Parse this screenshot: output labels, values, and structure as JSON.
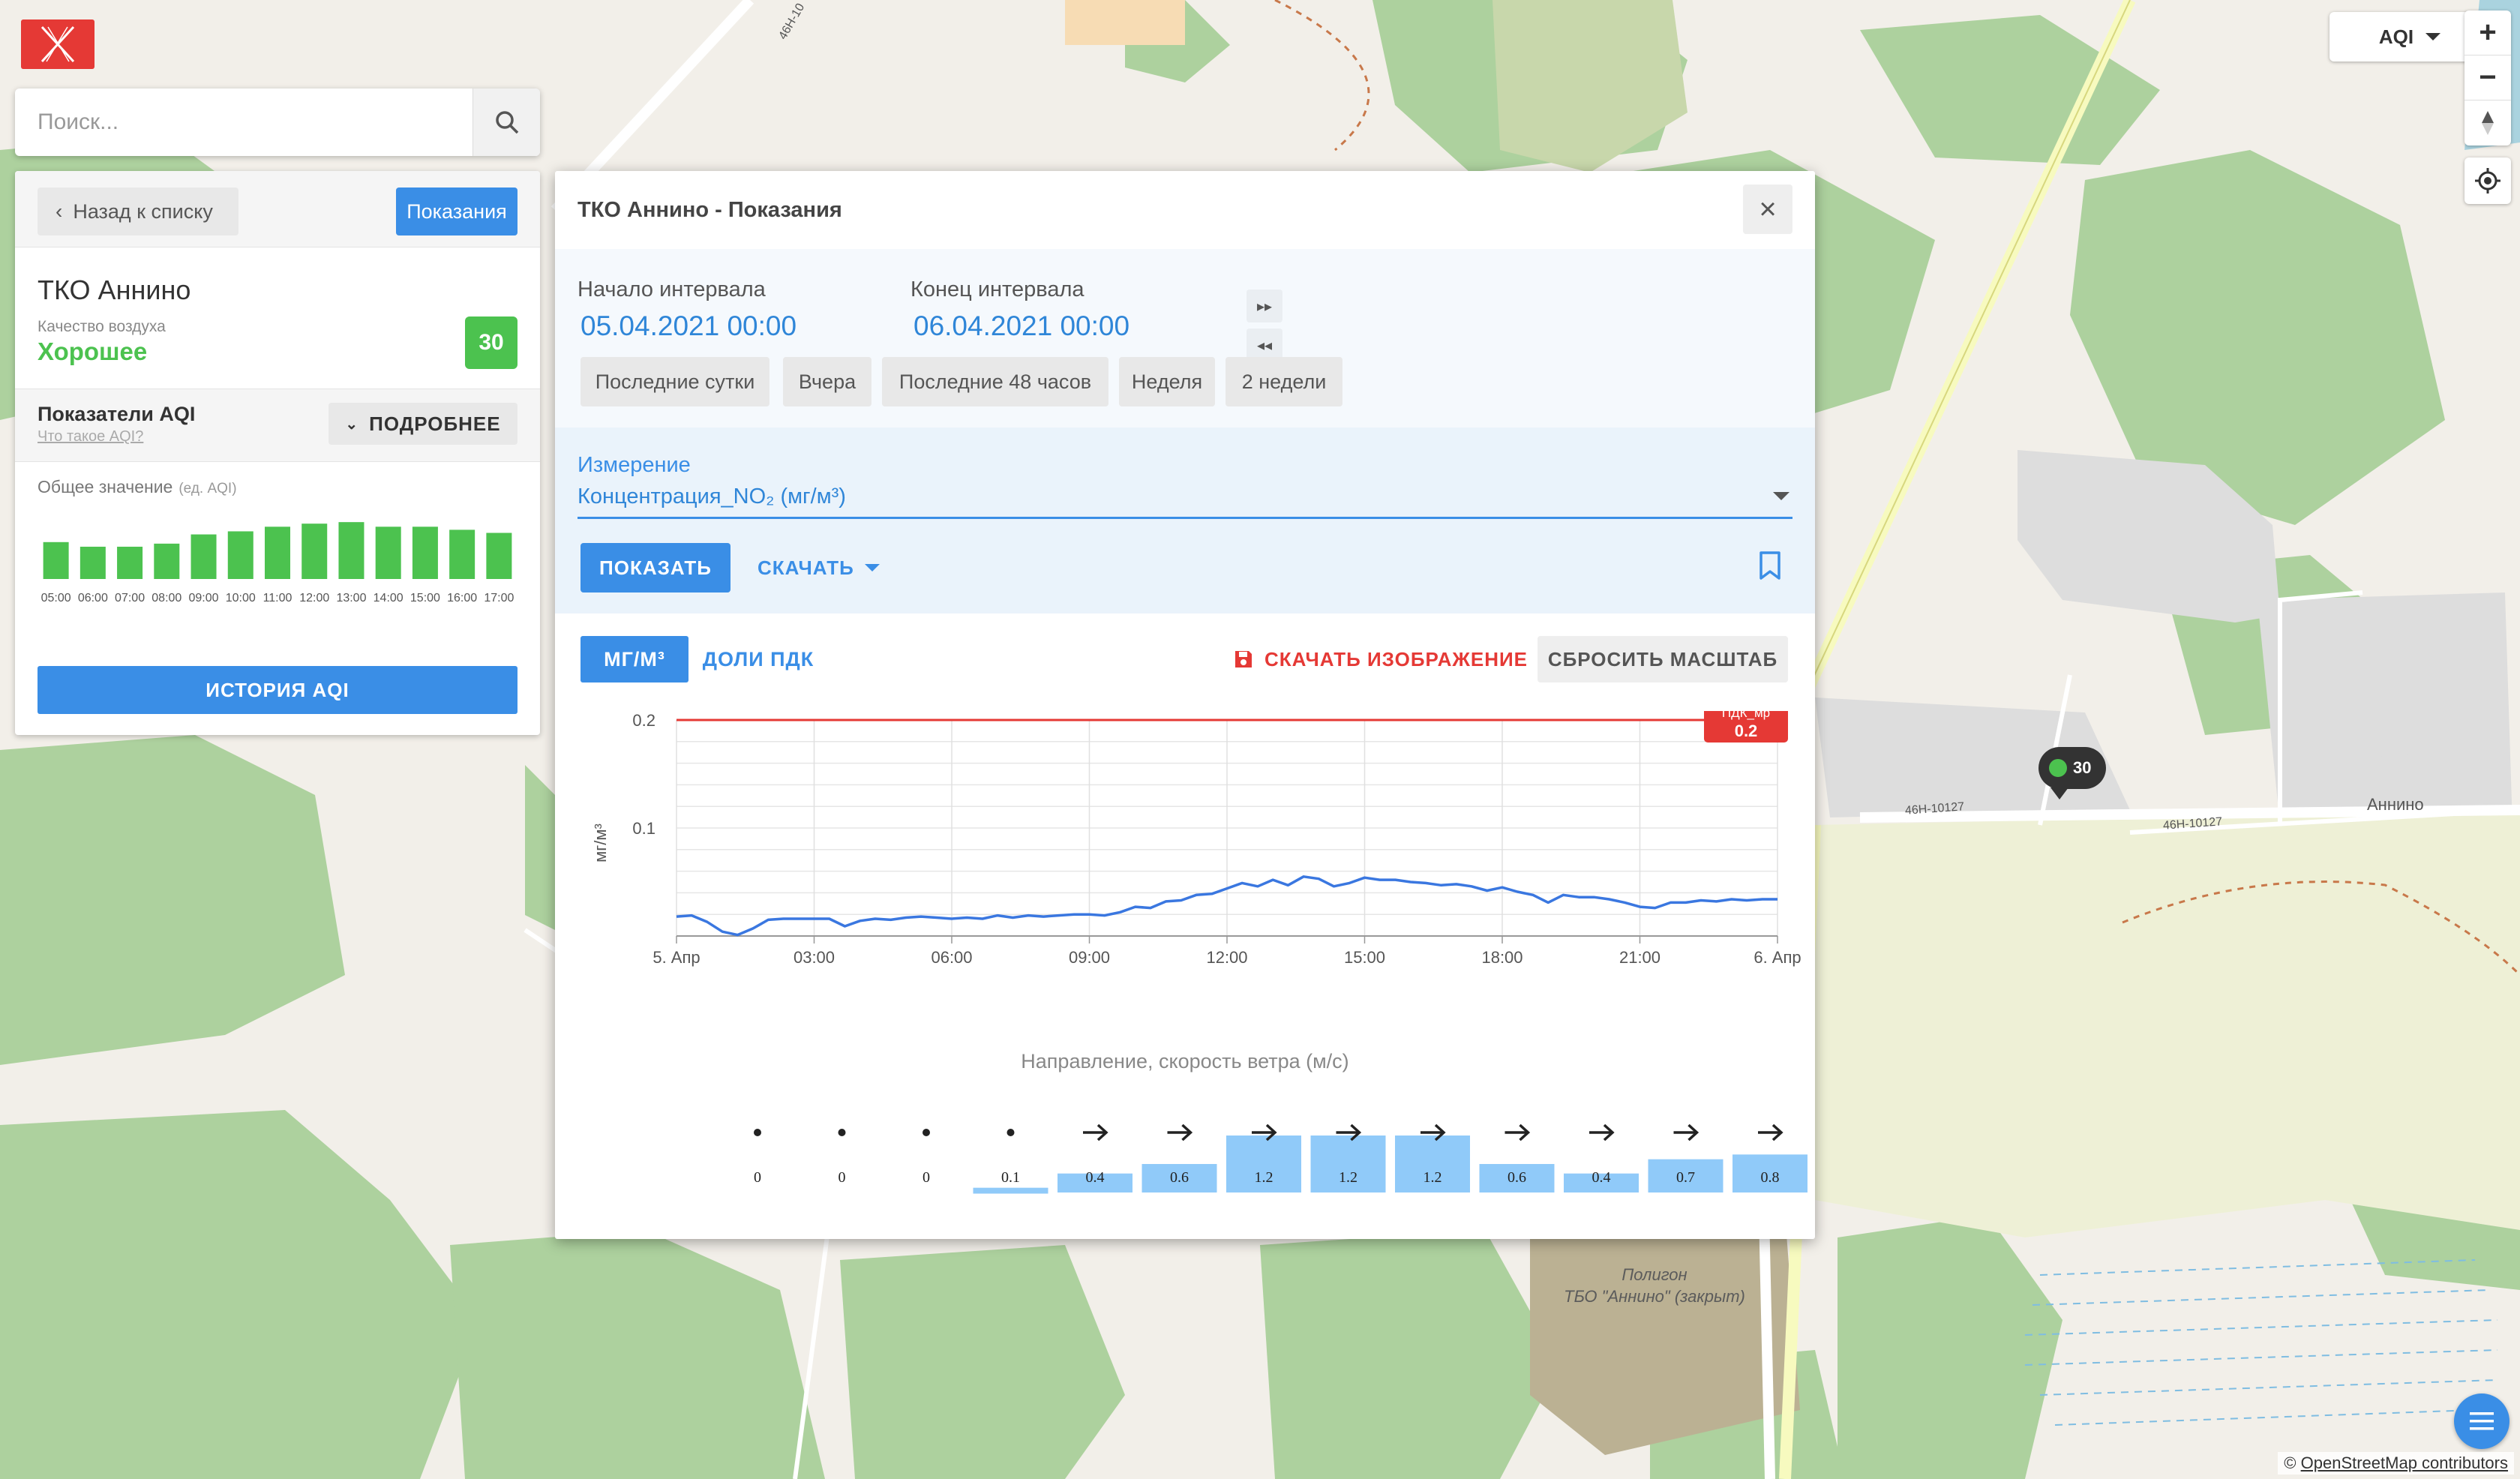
{
  "search": {
    "placeholder": "Поиск..."
  },
  "panel": {
    "back_label": "Назад к списку",
    "readings_label": "Показания",
    "station_name": "ТКО Аннино",
    "air_quality_label": "Качество воздуха",
    "air_quality_value": "Хорошее",
    "aqi_value": "30",
    "aqi_section_title": "Показатели AQI",
    "aqi_what_link": "Что такое AQI?",
    "more_label": "ПОДРОБНЕЕ",
    "overall_label": "Общее значение",
    "overall_unit": "(ед. AQI)",
    "mini_chart": {
      "hours": [
        "05:00",
        "06:00",
        "07:00",
        "08:00",
        "09:00",
        "10:00",
        "11:00",
        "12:00",
        "13:00",
        "14:00",
        "15:00",
        "16:00",
        "17:00"
      ],
      "values": [
        24,
        21,
        21,
        23,
        29,
        31,
        34,
        36,
        37,
        34,
        34,
        32,
        30
      ],
      "color": "#4cc24f"
    },
    "history_label": "ИСТОРИЯ AQI"
  },
  "map": {
    "aqi_dropdown": "AQI",
    "zoom_in": "+",
    "zoom_out": "−",
    "marker_value": "30",
    "place_annino": "Аннино",
    "road_1": "46Н-10127",
    "road_2": "46Н-10127",
    "road_3": "46Н-10",
    "polygon_line1": "Полигон",
    "polygon_line2": "ТБО \"Аннино\" (закрыт)",
    "attribution_prefix": "©",
    "attribution_link": "OpenStreetMap contributors"
  },
  "modal": {
    "title": "ТКО Аннино - Показания",
    "start_label": "Начало интервала",
    "start_value": "05.04.2021 00:00",
    "end_label": "Конец интервала",
    "end_value": "06.04.2021 00:00",
    "quick_ranges": [
      "Последние сутки",
      "Вчера",
      "Последние 48 часов",
      "Неделя",
      "2 недели"
    ],
    "measure_label": "Измерение",
    "measure_value": "Концентрация_NO₂ (мг/м³)",
    "show_label": "ПОКАЗАТЬ",
    "download_label": "СКАЧАТЬ",
    "unit_tab_active": "МГ/М³",
    "unit_tab_other": "ДОЛИ ПДК",
    "download_image_label": "СКАЧАТЬ ИЗОБРАЖЕНИЕ",
    "reset_zoom_label": "СБРОСИТЬ МАСШТАБ",
    "wind_title": "Направление, скорость ветра (м/с)"
  },
  "chart_data": {
    "type": "line",
    "title": "",
    "xlabel": "",
    "ylabel": "мг/м³",
    "ylim": [
      0,
      0.2
    ],
    "yticks": [
      "0.1",
      "0.2"
    ],
    "xtick_labels": [
      "5. Апр",
      "03:00",
      "06:00",
      "09:00",
      "12:00",
      "15:00",
      "18:00",
      "21:00",
      "6. Апр"
    ],
    "x_range_hours": [
      0,
      24
    ],
    "grid": true,
    "line_color": "#3a77e0",
    "threshold": {
      "label": "ПДК_мр",
      "value": 0.2,
      "color": "#e53935",
      "label_value": "0.2"
    },
    "series": [
      {
        "x": [
          0,
          0.33,
          0.67,
          1,
          1.33,
          1.67,
          2,
          2.33,
          2.67,
          3,
          3.33,
          3.67,
          4,
          4.33,
          4.67,
          5,
          5.33,
          5.67,
          6,
          6.33,
          6.67,
          7,
          7.33,
          7.67,
          8,
          8.33,
          8.67,
          9,
          9.33,
          9.67,
          10,
          10.33,
          10.67,
          11,
          11.33,
          11.67,
          12,
          12.33,
          12.67,
          13,
          13.33,
          13.67,
          14,
          14.33,
          14.67,
          15,
          15.33,
          15.67,
          16,
          16.33,
          16.67,
          17,
          17.33,
          17.67,
          18,
          18.33,
          18.67,
          19,
          19.33,
          19.67,
          20,
          20.33,
          20.67,
          21,
          21.33,
          21.67,
          22,
          22.33,
          22.67,
          23,
          23.33,
          23.67,
          24
        ],
        "values": [
          0.018,
          0.019,
          0.013,
          0.004,
          0.001,
          0.007,
          0.015,
          0.016,
          0.016,
          0.016,
          0.016,
          0.009,
          0.014,
          0.016,
          0.015,
          0.017,
          0.018,
          0.017,
          0.016,
          0.017,
          0.016,
          0.019,
          0.017,
          0.019,
          0.018,
          0.019,
          0.02,
          0.02,
          0.019,
          0.022,
          0.027,
          0.026,
          0.032,
          0.033,
          0.038,
          0.039,
          0.044,
          0.049,
          0.046,
          0.052,
          0.047,
          0.055,
          0.053,
          0.046,
          0.049,
          0.054,
          0.052,
          0.052,
          0.05,
          0.049,
          0.047,
          0.048,
          0.046,
          0.042,
          0.045,
          0.041,
          0.038,
          0.031,
          0.038,
          0.036,
          0.036,
          0.034,
          0.031,
          0.027,
          0.026,
          0.031,
          0.031,
          0.033,
          0.032,
          0.034,
          0.033,
          0.034,
          0.034
        ]
      }
    ]
  },
  "wind_data": {
    "speeds": [
      "0",
      "0",
      "0",
      "0.1",
      "0.4",
      "0.6",
      "1.2",
      "1.2",
      "1.2",
      "0.6",
      "0.4",
      "0.7",
      "0.8"
    ],
    "max_speed": 1.2,
    "bar_color": "#90caf9"
  }
}
